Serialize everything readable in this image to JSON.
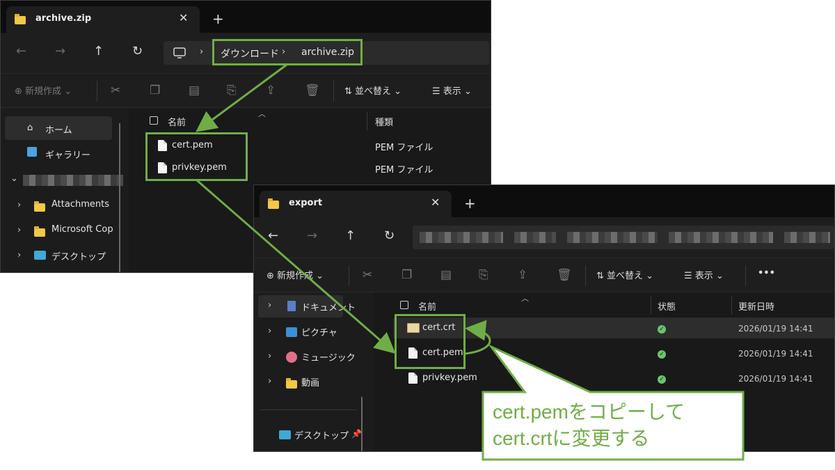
{
  "window1": {
    "tab_title": "archive.zip",
    "close": "✕",
    "plus": "+",
    "breadcrumb": [
      "ダウンロード",
      "archive.zip"
    ],
    "toolbar": {
      "new": "新規作成",
      "sort": "並べ替え",
      "view": "表示"
    },
    "sidebar": {
      "home": "ホーム",
      "gallery": "ギャラリー",
      "attachments": "Attachments",
      "copilot": "Microsoft Cop",
      "desktop": "デスクトップ"
    },
    "columns": {
      "name": "名前",
      "type": "種類"
    },
    "files": [
      {
        "name": "cert.pem",
        "type": "PEM ファイル"
      },
      {
        "name": "privkey.pem",
        "type": "PEM ファイル"
      }
    ]
  },
  "window2": {
    "tab_title": "export",
    "close": "✕",
    "plus": "+",
    "toolbar": {
      "new": "新規作成",
      "sort": "並べ替え",
      "view": "表示",
      "more": "•••"
    },
    "sidebar": {
      "documents": "ドキュメント",
      "pictures": "ピクチャ",
      "music": "ミュージック",
      "videos": "動画",
      "desktop": "デスクトップ"
    },
    "columns": {
      "name": "名前",
      "status": "状態",
      "modified": "更新日時"
    },
    "files": [
      {
        "name": "cert.crt",
        "modified": "2026/01/19 14:41"
      },
      {
        "name": "cert.pem",
        "modified": "2026/01/19 14:41"
      },
      {
        "name": "privkey.pem",
        "modified": "2026/01/19 14:41"
      }
    ]
  },
  "callout": {
    "line1": "cert.pemをコピーして",
    "line2": "cert.crtに変更する"
  },
  "colors": {
    "accent_green": "#70ad47",
    "window_bg": "#1c1c1c",
    "status_ok": "#6cc46c"
  },
  "icons": [
    "folder-icon",
    "back-icon",
    "forward-icon",
    "up-icon",
    "refresh-icon",
    "monitor-icon",
    "cut-icon",
    "copy-icon",
    "paste-icon",
    "rename-icon",
    "share-icon",
    "delete-icon",
    "home-icon",
    "gallery-icon",
    "file-icon",
    "certificate-icon",
    "pin-icon"
  ]
}
